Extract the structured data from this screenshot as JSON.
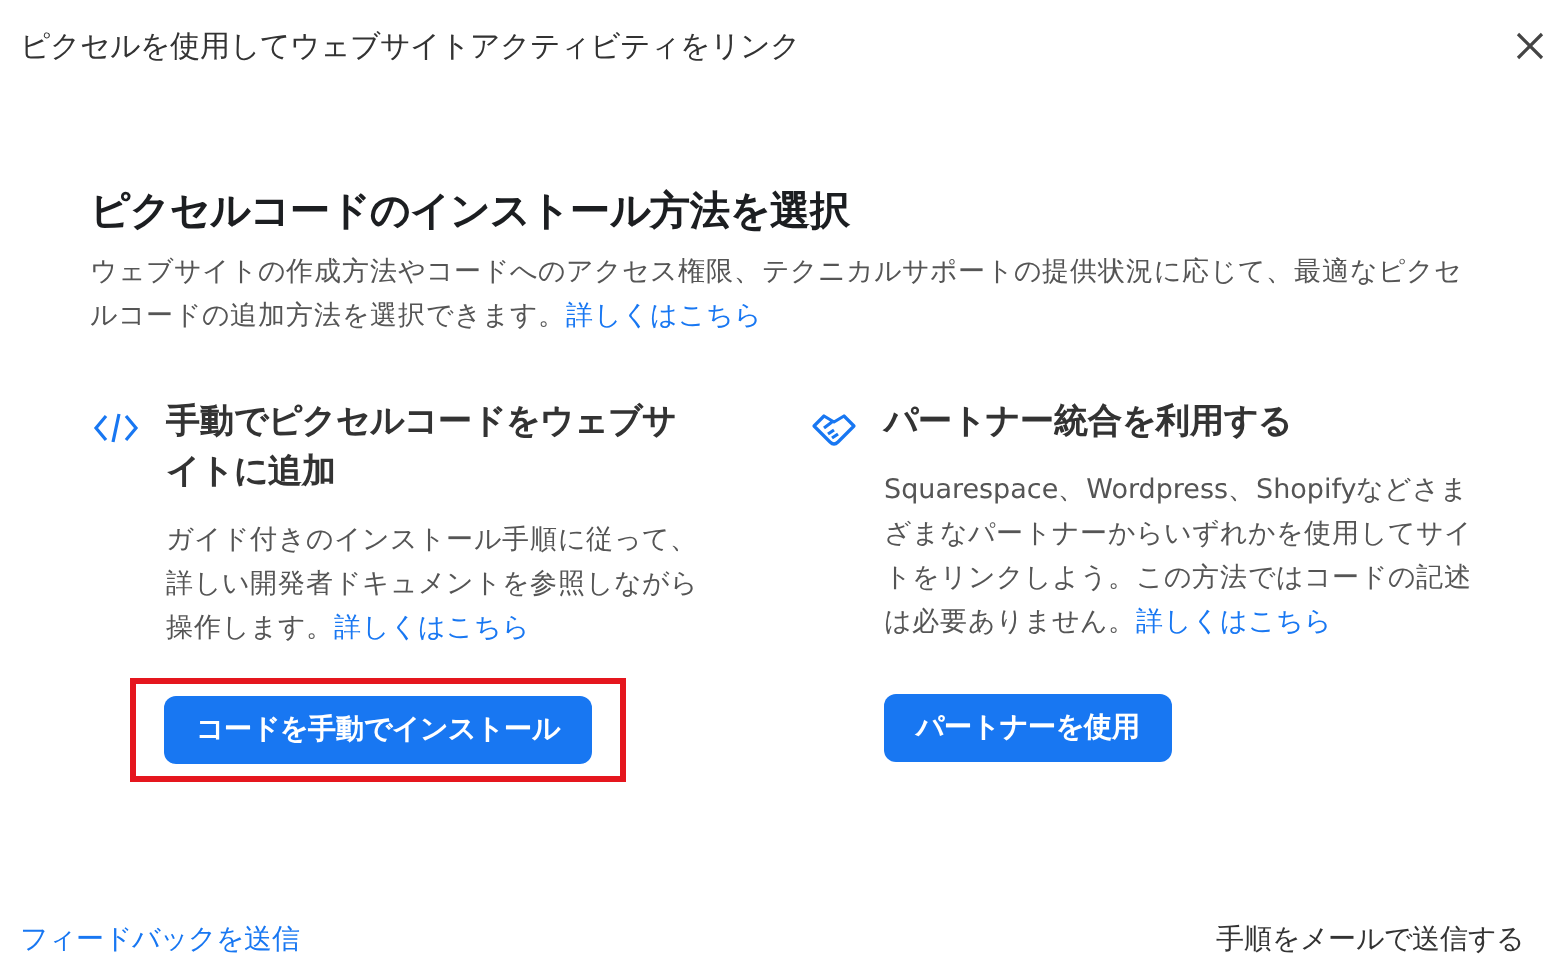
{
  "window": {
    "title": "ピクセルを使用してウェブサイトアクティビティをリンク"
  },
  "heading": "ピクセルコードのインストール方法を選択",
  "description": {
    "text": "ウェブサイトの作成方法やコードへのアクセス権限、テクニカルサポートの提供状況に応じて、最適なピクセルコードの追加方法を選択できます。",
    "link": "詳しくはこちら"
  },
  "options": [
    {
      "kind": "code",
      "title": "手動でピクセルコードをウェブサイトに追加",
      "description": "ガイド付きのインストール手順に従って、詳しい開発者ドキュメントを参照しながら操作します。",
      "link": "詳しくはこちら",
      "button": "コードを手動でインストール",
      "highlighted": true
    },
    {
      "kind": "partner",
      "title": "パートナー統合を利用する",
      "description": "Squarespace、Wordpress、Shopifyなどさまざまなパートナーからいずれかを使用してサイトをリンクしよう。この方法ではコードの記述は必要ありません。",
      "link": "詳しくはこちら",
      "button": "パートナーを使用",
      "highlighted": false
    }
  ],
  "footer": {
    "left_link": "フィードバックを送信",
    "right_link": "手順をメールで送信する"
  }
}
